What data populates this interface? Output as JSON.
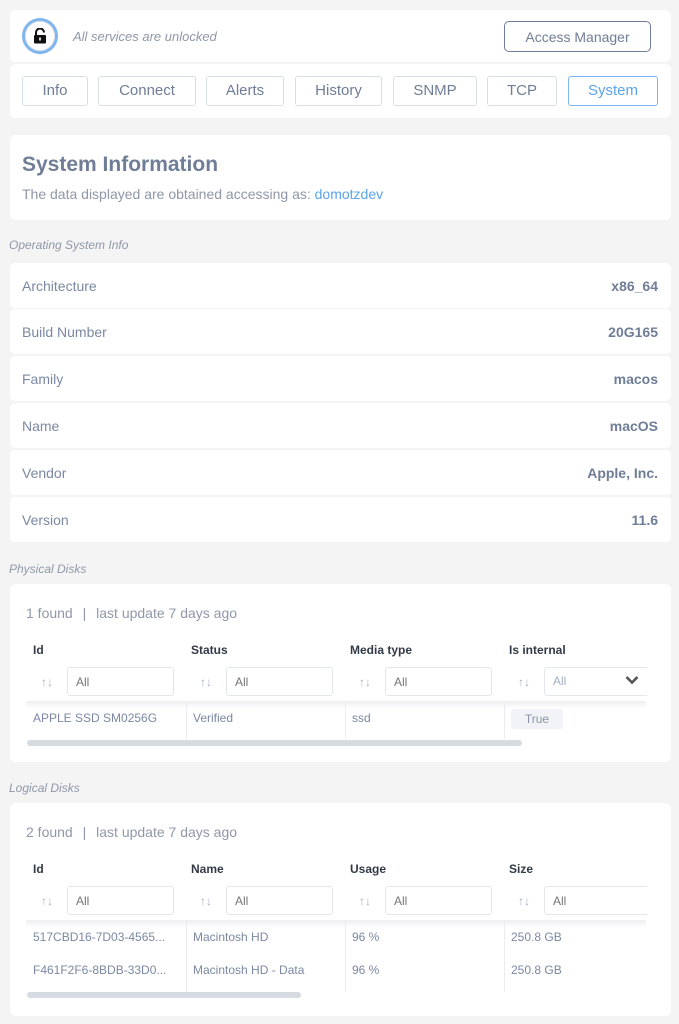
{
  "header": {
    "lock_status": "All services are unlocked",
    "lock_icon": "unlocked-padlock-icon",
    "access_button": "Access Manager"
  },
  "tabs": [
    {
      "label": "Info",
      "active": false
    },
    {
      "label": "Connect",
      "active": false
    },
    {
      "label": "Alerts",
      "active": false
    },
    {
      "label": "History",
      "active": false
    },
    {
      "label": "SNMP",
      "active": false
    },
    {
      "label": "TCP",
      "active": false
    },
    {
      "label": "System",
      "active": true
    }
  ],
  "system": {
    "title": "System Information",
    "subtitle_prefix": "The data displayed are obtained accessing as: ",
    "user": "domotzdev"
  },
  "os_info": {
    "label": "Operating System Info",
    "rows": [
      {
        "key": "Architecture",
        "value": "x86_64"
      },
      {
        "key": "Build Number",
        "value": "20G165"
      },
      {
        "key": "Family",
        "value": "macos"
      },
      {
        "key": "Name",
        "value": "macOS"
      },
      {
        "key": "Vendor",
        "value": "Apple, Inc."
      },
      {
        "key": "Version",
        "value": "11.6"
      }
    ]
  },
  "physical_disks": {
    "label": "Physical Disks",
    "found": "1 found",
    "separator": "|",
    "last_update": "last update 7 days ago",
    "columns": [
      "Id",
      "Status",
      "Media type",
      "Is internal"
    ],
    "filter_placeholder": "All",
    "select_value": "All",
    "rows": [
      [
        "APPLE SSD SM0256G",
        "Verified",
        "ssd",
        "True"
      ]
    ]
  },
  "logical_disks": {
    "label": "Logical Disks",
    "found": "2 found",
    "separator": "|",
    "last_update": "last update 7 days ago",
    "columns": [
      "Id",
      "Name",
      "Usage",
      "Size"
    ],
    "filter_placeholder": "All",
    "rows": [
      [
        "517CBD16-7D03-4565...",
        "Macintosh HD",
        "96 %",
        "250.8 GB"
      ],
      [
        "F461F2F6-8BDB-33D0...",
        "Macintosh HD - Data",
        "96 %",
        "250.8 GB"
      ]
    ]
  },
  "colors": {
    "accent": "#5aa4ee",
    "text": "#6f7d97",
    "background": "#f4f4f5"
  }
}
